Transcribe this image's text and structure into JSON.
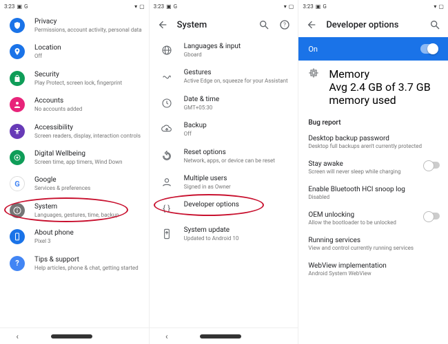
{
  "status_bar": {
    "time": "3:23",
    "square_icon": "▣",
    "g_icon": "G",
    "signal_icon": "▾",
    "battery_icon": "▢"
  },
  "screen1": {
    "items": [
      {
        "label": "Privacy",
        "sub": "Permissions, account activity, personal data",
        "icon": "shield",
        "bg": "#1a73e8"
      },
      {
        "label": "Location",
        "sub": "Off",
        "icon": "pin",
        "bg": "#1a73e8"
      },
      {
        "label": "Security",
        "sub": "Play Protect, screen lock, fingerprint",
        "icon": "lock",
        "bg": "#0f9d58"
      },
      {
        "label": "Accounts",
        "sub": "No accounts added",
        "icon": "person",
        "bg": "#e8247a"
      },
      {
        "label": "Accessibility",
        "sub": "Screen readers, display, interaction controls",
        "icon": "a11y",
        "bg": "#673ab7"
      },
      {
        "label": "Digital Wellbeing",
        "sub": "Screen time, app timers, Wind Down",
        "icon": "wellbeing",
        "bg": "#0f9d58"
      },
      {
        "label": "Google",
        "sub": "Services & preferences",
        "icon": "google",
        "bg": "#ffffff"
      },
      {
        "label": "System",
        "sub": "Languages, gestures, time, backup",
        "icon": "info",
        "bg": "#757575"
      },
      {
        "label": "About phone",
        "sub": "Pixel 3",
        "icon": "phone",
        "bg": "#1a73e8"
      },
      {
        "label": "Tips & support",
        "sub": "Help articles, phone & chat, getting started",
        "icon": "help",
        "bg": "#4285f4"
      }
    ]
  },
  "screen2": {
    "title": "System",
    "items": [
      {
        "label": "Languages & input",
        "sub": "Gboard",
        "icon": "globe"
      },
      {
        "label": "Gestures",
        "sub": "Active Edge on, squeeze for your Assistant",
        "icon": "gesture"
      },
      {
        "label": "Date & time",
        "sub": "GMT+05:30",
        "icon": "clock"
      },
      {
        "label": "Backup",
        "sub": "Off",
        "icon": "backup"
      },
      {
        "label": "Reset options",
        "sub": "Network, apps, or device can be reset",
        "icon": "reset"
      },
      {
        "label": "Multiple users",
        "sub": "Signed in as Owner",
        "icon": "users"
      },
      {
        "label": "Developer options",
        "sub": "",
        "icon": "braces"
      },
      {
        "label": "System update",
        "sub": "Updated to Android 10",
        "icon": "update"
      }
    ]
  },
  "screen3": {
    "title": "Developer options",
    "on_label": "On",
    "memory": {
      "label": "Memory",
      "sub": "Avg 2.4 GB of 3.7 GB memory used"
    },
    "bug_report_header": "Bug report",
    "items": [
      {
        "label": "Desktop backup password",
        "sub": "Desktop full backups aren't currently protected",
        "switch": false
      },
      {
        "label": "Stay awake",
        "sub": "Screen will never sleep while charging",
        "switch": true
      },
      {
        "label": "Enable Bluetooth HCI snoop log",
        "sub": "Disabled",
        "switch": false
      },
      {
        "label": "OEM unlocking",
        "sub": "Allow the bootloader to be unlocked",
        "switch": true
      },
      {
        "label": "Running services",
        "sub": "View and control currently running services",
        "switch": false
      },
      {
        "label": "WebView implementation",
        "sub": "Android System WebView",
        "switch": false
      }
    ]
  }
}
